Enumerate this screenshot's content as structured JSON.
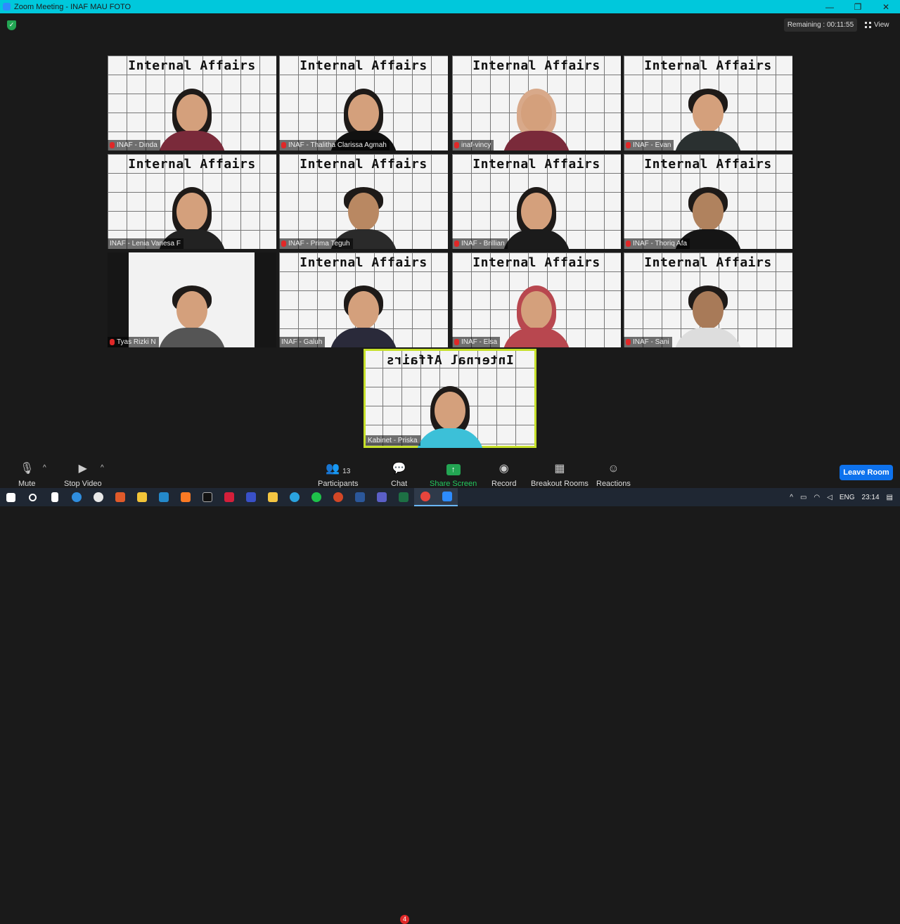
{
  "window": {
    "title": "Zoom Meeting - INAF MAU FOTO",
    "minimize": "—",
    "restore": "❐",
    "close": "✕"
  },
  "header": {
    "remaining": "Remaining : 00:11:55",
    "view_label": "View"
  },
  "tiles": [
    {
      "banner": "Internal Affairs",
      "name": "INAF - Dinda",
      "muted": true
    },
    {
      "banner": "Internal Affairs",
      "name": "INAF - Thalitha Clarissa Agmah",
      "muted": true
    },
    {
      "banner": "Internal Affairs",
      "name": "inaf-vincy",
      "muted": true
    },
    {
      "banner": "Internal Affairs",
      "name": "INAF - Evan",
      "muted": true
    },
    {
      "banner": "Internal Affairs",
      "name": "INAF - Lenia Vanesa F",
      "muted": false
    },
    {
      "banner": "Internal Affairs",
      "name": "INAF - Prima Teguh",
      "muted": true
    },
    {
      "banner": "Internal Affairs",
      "name": "INAF - Brillian",
      "muted": true
    },
    {
      "banner": "Internal Affairs",
      "name": "INAF - Thoriq Afa",
      "muted": true
    },
    {
      "banner": "",
      "name": "Tyas Rizki N",
      "muted": true
    },
    {
      "banner": "Internal Affairs",
      "name": "INAF - Galuh",
      "muted": false
    },
    {
      "banner": "Internal Affairs",
      "name": "INAF - Elsa",
      "muted": true
    },
    {
      "banner": "Internal Affairs",
      "name": "INAF - Sani",
      "muted": true
    },
    {
      "banner": "Internal Affairs",
      "name": "Kabinet - Priska",
      "muted": false
    }
  ],
  "toolbar": {
    "mute": "Mute",
    "stop_video": "Stop Video",
    "participants": "Participants",
    "participants_count": "13",
    "chat": "Chat",
    "chat_badge": "4",
    "share_screen": "Share Screen",
    "record": "Record",
    "breakout_rooms": "Breakout Rooms",
    "reactions": "Reactions",
    "leave_room": "Leave Room"
  },
  "taskbar": {
    "language": "ENG",
    "time": "23:14"
  },
  "colors": {
    "accent_share": "#23a553",
    "leave_button": "#0e72ed",
    "active_speaker": "#c6e02a",
    "titlebar": "#00c8dc"
  }
}
